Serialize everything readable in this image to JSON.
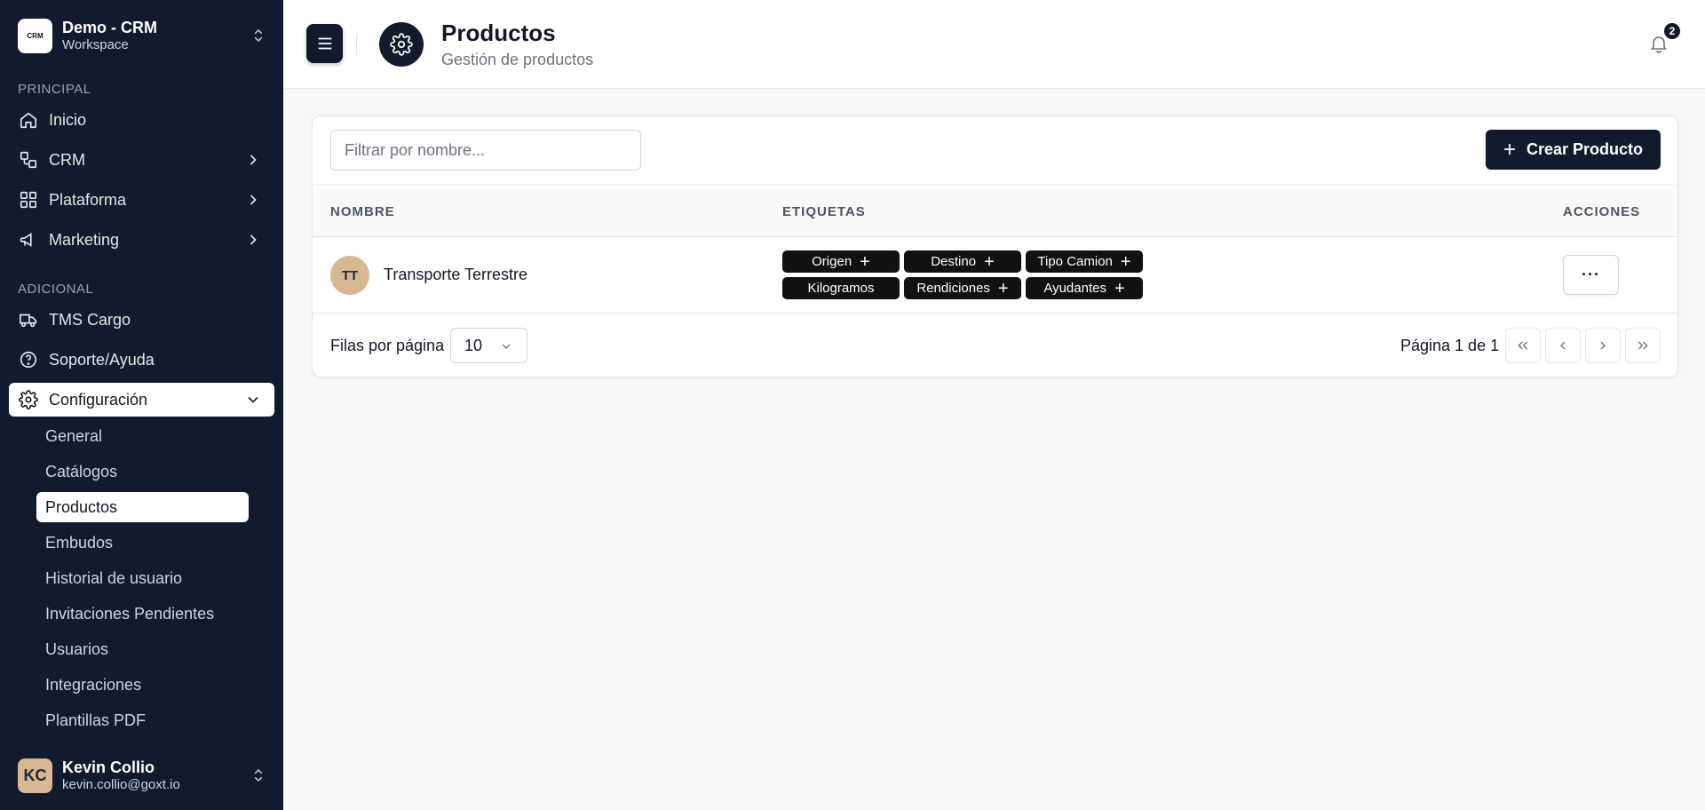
{
  "workspace": {
    "logo_text": "CRM",
    "name": "Demo - CRM",
    "sub": "Workspace"
  },
  "sidebar": {
    "section_principal": "PRINCIPAL",
    "section_adicional": "ADICIONAL",
    "items": {
      "inicio": "Inicio",
      "crm": "CRM",
      "plataforma": "Plataforma",
      "marketing": "Marketing",
      "tms": "TMS Cargo",
      "soporte": "Soporte/Ayuda",
      "config": "Configuración"
    },
    "sub_items": [
      "General",
      "Catálogos",
      "Productos",
      "Embudos",
      "Historial de usuario",
      "Invitaciones Pendientes",
      "Usuarios",
      "Integraciones",
      "Plantillas PDF"
    ],
    "active_sub": "Productos"
  },
  "user": {
    "initials": "KC",
    "name": "Kevin Collio",
    "email": "kevin.collio@goxt.io"
  },
  "header": {
    "title": "Productos",
    "subtitle": "Gestión de productos",
    "notification_count": "2"
  },
  "toolbar": {
    "filter_placeholder": "Filtrar por nombre...",
    "create_label": "Crear Producto"
  },
  "table": {
    "columns": {
      "name": "NOMBRE",
      "tags": "ETIQUETAS",
      "actions": "ACCIONES"
    },
    "rows": [
      {
        "initials": "TT",
        "name": "Transporte Terrestre",
        "tags": [
          "Origen",
          "Destino",
          "Tipo Camion",
          "Kilogramos",
          "Rendiciones",
          "Ayudantes"
        ],
        "actions_label": "···"
      }
    ]
  },
  "pagination": {
    "rows_label": "Filas por página",
    "rows_value": "10",
    "page_label": "Página 1 de 1"
  },
  "colors": {
    "sidebar_bg": "#121a2e",
    "accent": "#121a2e",
    "avatar_bg": "#d8b892",
    "tag_bg": "#111111"
  }
}
